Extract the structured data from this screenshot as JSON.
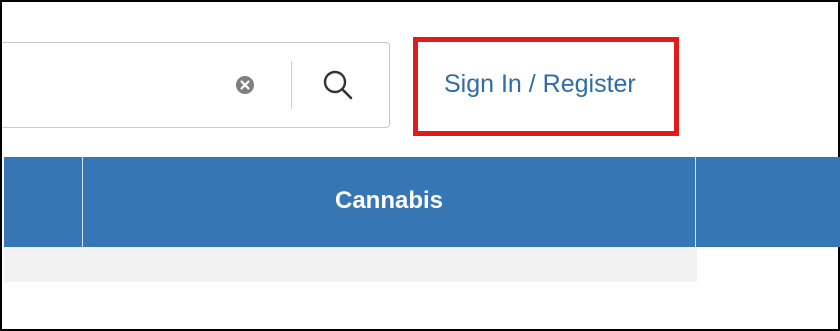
{
  "header": {
    "search": {
      "value": "",
      "placeholder": ""
    },
    "clear_icon": "close-circle-icon",
    "search_icon": "magnifier-icon",
    "signin_label": "Sign In / Register",
    "highlight_color": "#e01b1b"
  },
  "nav": {
    "items": [
      {
        "label": ""
      },
      {
        "label": "Cannabis"
      },
      {
        "label": ""
      }
    ],
    "background": "#3676b4"
  },
  "colors": {
    "link": "#2e6da8",
    "nav_text": "#ffffff",
    "subnav_bg": "#f2f2f2"
  }
}
